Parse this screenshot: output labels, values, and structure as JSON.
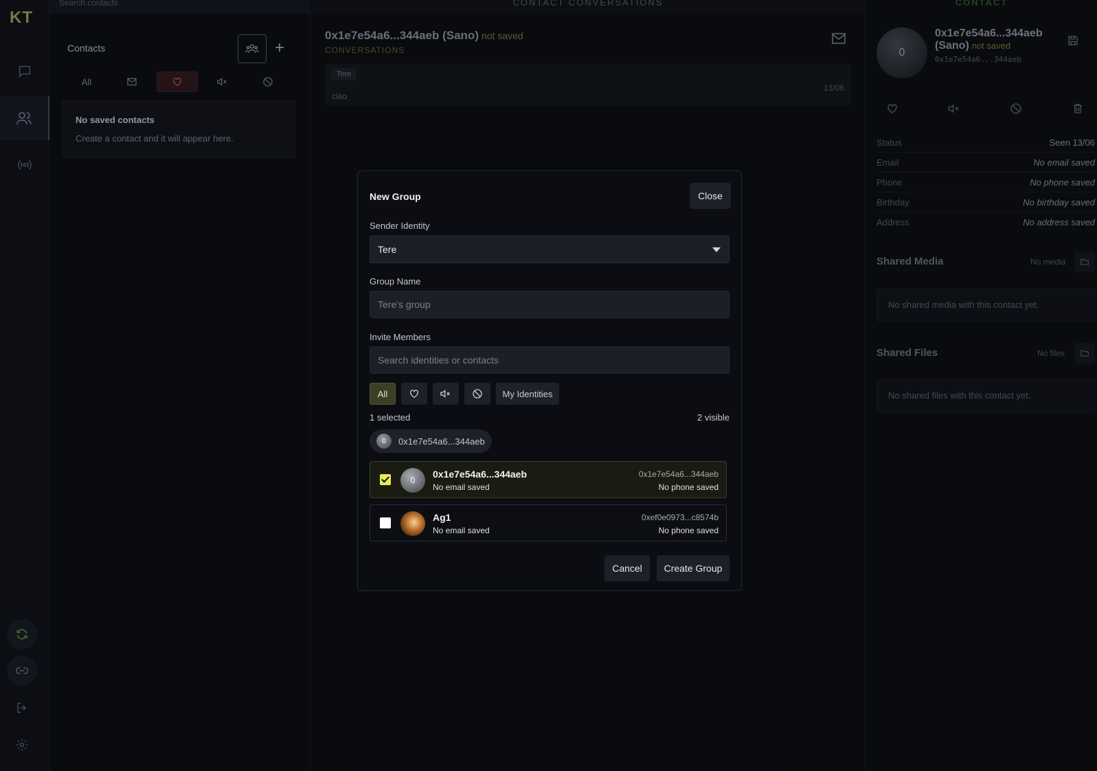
{
  "app": {
    "logo": "KT"
  },
  "contacts_panel": {
    "search_placeholder": "Search contacts",
    "title": "Contacts",
    "filters": {
      "all": "All"
    },
    "empty_title": "No saved contacts",
    "empty_body": "Create a contact and it will appear here."
  },
  "conversation": {
    "header": "CONTACT CONVERSATIONS",
    "name": "0x1e7e54a6...344aeb (Sano)",
    "status": "not saved",
    "subtitle": "CONVERSATIONS",
    "message": {
      "tag": "Tere",
      "text": "ciao",
      "date": "13/06"
    }
  },
  "detail": {
    "header": "CONTACT",
    "avatar_initial": "0",
    "name": "0x1e7e54a6...344aeb (Sano)",
    "status": "not saved",
    "address": "0x1e7e54a6...344aeb",
    "rows": [
      {
        "key": "Status",
        "value": "Seen 13/06"
      },
      {
        "key": "Email",
        "value": "No email saved"
      },
      {
        "key": "Phone",
        "value": "No phone saved"
      },
      {
        "key": "Birthday",
        "value": "No birthday saved"
      },
      {
        "key": "Address",
        "value": "No address saved"
      }
    ],
    "shared_media": {
      "title": "Shared Media",
      "meta": "No media",
      "empty": "No shared media with this contact yet."
    },
    "shared_files": {
      "title": "Shared Files",
      "meta": "No files",
      "empty": "No shared files with this contact yet."
    }
  },
  "modal": {
    "title": "New Group",
    "close_label": "Close",
    "sender_label": "Sender Identity",
    "sender_value": "Tere",
    "group_name_label": "Group Name",
    "group_name_placeholder": "Tere's group",
    "invite_label": "Invite Members",
    "invite_placeholder": "Search identities or contacts",
    "filter_all": "All",
    "filter_identities": "My Identities",
    "selected_count": "1 selected",
    "visible_count": "2 visible",
    "selected_pill": {
      "initial": "0",
      "label": "0x1e7e54a6...344aeb"
    },
    "members": [
      {
        "initial": "0",
        "name": "0x1e7e54a6...344aeb",
        "email": "No email saved",
        "address": "0x1e7e54a6...344aeb",
        "phone": "No phone saved",
        "checked": true
      },
      {
        "initial": "",
        "name": "Ag1",
        "email": "No email saved",
        "address": "0xef0e0973...c8574b",
        "phone": "No phone saved",
        "checked": false
      }
    ],
    "cancel_label": "Cancel",
    "create_label": "Create Group"
  },
  "colors": {
    "accent_olive": "#e6ea59",
    "favorite_red": "#b0454f",
    "not_saved": "#6b6a30"
  }
}
